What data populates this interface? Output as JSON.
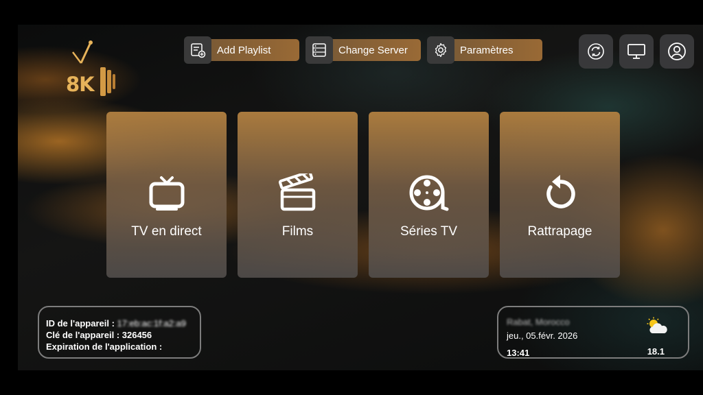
{
  "logo": {
    "text": "8K"
  },
  "toolbar": {
    "add_playlist": "Add Playlist",
    "change_server": "Change Server",
    "settings": "Paramètres"
  },
  "icons": {
    "add_playlist": "playlist-add-icon",
    "change_server": "server-list-icon",
    "settings": "gear-icon",
    "refresh": "refresh-icon",
    "screen": "monitor-icon",
    "profile": "user-icon"
  },
  "tiles": [
    {
      "label": "TV en direct",
      "icon": "tv-icon"
    },
    {
      "label": "Films",
      "icon": "clapperboard-icon"
    },
    {
      "label": "Séries TV",
      "icon": "film-reel-icon"
    },
    {
      "label": "Rattrapage",
      "icon": "replay-icon"
    }
  ],
  "device": {
    "id_label": "ID de l'appareil : ",
    "id_value": "17:eb:ac:1f:a2:a9",
    "key_label": "Clé de l'appareil : ",
    "key_value": "326456",
    "expiry_label": "Expiration de l'application :",
    "expiry_value": ""
  },
  "weather": {
    "location": "Rabat, Morocco",
    "date": "jeu., 05.févr. 2026",
    "time": "13:41",
    "temperature": "18.1",
    "icon": "partly-cloudy-icon"
  },
  "colors": {
    "accent": "#e7b35a",
    "tile_top": "#b28040",
    "tile_bottom": "#524e4c"
  }
}
